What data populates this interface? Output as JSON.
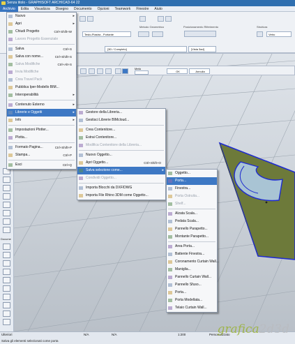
{
  "window_title": "Senza titolo - GRAPHISOFT ARCHICAD-64 22",
  "menubar": [
    "Archivio",
    "Edita",
    "Visualizza",
    "Disegno",
    "Documento",
    "Opzioni",
    "Teamwork",
    "Finestre",
    "Aiuto"
  ],
  "ribbon": {
    "active_tool_combo": "Testo-Piastra - Portante",
    "group_metodo": "Metodo Geometrico",
    "group_posizione": "Posizionamento Riferimento",
    "group_struttura": "Struttura",
    "struttura_value": "Vetro"
  },
  "tabs": {
    "tab1": "[3D / Completo]",
    "tab2": "[Vista 3ad]"
  },
  "infobar": {
    "field_label": "Metà",
    "ok": "OK",
    "cancel": "Annulla"
  },
  "toolbox_sections": {
    "docume": "Docume"
  },
  "file_menu": {
    "items": [
      {
        "label": "Nuovo",
        "arrow": true
      },
      {
        "label": "Apri",
        "arrow": true
      },
      {
        "label": "Chiudi Progetto",
        "shortcut": "Ctrl+Shift+W"
      },
      {
        "label": "Lavoro Progetto Essenziale",
        "disabled": true
      },
      {
        "sep": true
      },
      {
        "label": "Salva",
        "shortcut": "Ctrl+S"
      },
      {
        "label": "Salva con nome...",
        "shortcut": "Ctrl+Shift+S"
      },
      {
        "label": "Salva Modifiche",
        "shortcut": "Ctrl+Alt+S",
        "disabled": true
      },
      {
        "label": "Invia Modifiche",
        "disabled": true
      },
      {
        "label": "Crea Travel Pack",
        "disabled": true
      },
      {
        "label": "Pubblica Iper-Modello BIM..."
      },
      {
        "label": "Interoperabilità",
        "arrow": true
      },
      {
        "sep": true
      },
      {
        "label": "Contenuto Esterno",
        "arrow": true
      },
      {
        "label": "Librerie e Oggetti",
        "arrow": true,
        "highlight": true
      },
      {
        "label": "Info",
        "arrow": true
      },
      {
        "sep": true
      },
      {
        "label": "Impostazioni Plotter..."
      },
      {
        "label": "Plotta..."
      },
      {
        "sep": true
      },
      {
        "label": "Formato Pagina...",
        "shortcut": "Ctrl+Shift+P"
      },
      {
        "label": "Stampa...",
        "shortcut": "Ctrl+P"
      },
      {
        "sep": true
      },
      {
        "label": "Esci",
        "shortcut": "Ctrl+Q"
      }
    ]
  },
  "libraries_menu": {
    "items": [
      {
        "label": "Gestore della Libreria..."
      },
      {
        "label": "Gestisci Librerie BIMcloud...",
        "disabled": false
      },
      {
        "sep": true
      },
      {
        "label": "Crea Contenitore..."
      },
      {
        "label": "Estrai Contenitore..."
      },
      {
        "label": "Modifica Contenitore della Libreria...",
        "disabled": true
      },
      {
        "sep": true
      },
      {
        "label": "Nuovo Oggetto..."
      },
      {
        "label": "Apri Oggetto...",
        "shortcut": "Ctrl+Shift+O"
      },
      {
        "label": "Salva selezione come...",
        "arrow": true,
        "highlight": true
      },
      {
        "label": "Condividi Oggetto...",
        "disabled": true
      },
      {
        "sep": true
      },
      {
        "label": "Importa Blocchi da DXF/DWG"
      },
      {
        "label": "Importa File Rhino 3DM come Oggetto..."
      }
    ]
  },
  "save_as_menu": {
    "items": [
      {
        "label": "Oggetto..."
      },
      {
        "label": "Porta...",
        "highlight": true
      },
      {
        "label": "Finestra..."
      },
      {
        "label": "Porta Ostruita...",
        "disabled": true
      },
      {
        "label": "Shelf...",
        "disabled": true
      },
      {
        "sep": true
      },
      {
        "label": "Alzata Scala..."
      },
      {
        "label": "Pedata Scala..."
      },
      {
        "label": "Pannello Parapetto..."
      },
      {
        "label": "Montante Parapetto..."
      },
      {
        "sep": true
      },
      {
        "label": "Area Porta..."
      },
      {
        "label": "Battente Finestra..."
      },
      {
        "label": "Coronamento Curtain Wall..."
      },
      {
        "label": "Maniglia..."
      },
      {
        "label": "Pannello Curtain Wall..."
      },
      {
        "label": "Pannello Sfuso..."
      },
      {
        "label": "Porta..."
      },
      {
        "label": "Porta Modellata..."
      },
      {
        "label": "Telaio Curtain Wall..."
      }
    ]
  },
  "status_bar": {
    "message": "Salva gli elementi selezionati come porta",
    "left_label": "Ulteriori",
    "na1": "N/A",
    "na2": "N/A",
    "zoom": "1:200",
    "custom": "Personalizzato"
  },
  "watermark": {
    "green": "grafica",
    "grey": "2d3d"
  },
  "colors": {
    "menu_highlight": "#3d78c4",
    "slab_fill": "#6d7a3a",
    "slab_edge": "#1e2bd0",
    "title_bar": "#2f6fb0"
  },
  "icons": [
    "close-icon",
    "open-folder-icon",
    "save-icon",
    "printer-icon",
    "plotter-icon",
    "library-icon",
    "door-icon",
    "window-icon",
    "object-icon",
    "stair-icon"
  ]
}
